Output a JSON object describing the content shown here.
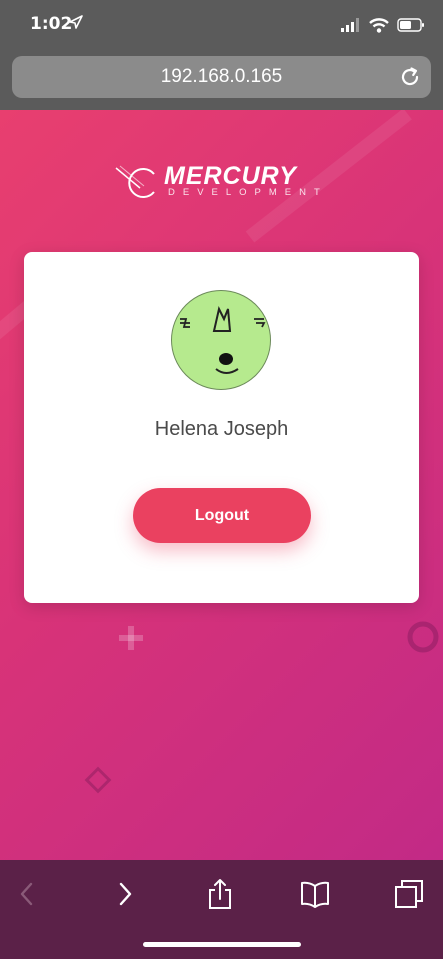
{
  "status_bar": {
    "time": "1:02",
    "icons": [
      "location-arrow-icon",
      "signal-icon",
      "wifi-icon",
      "battery-icon"
    ]
  },
  "browser": {
    "url": "192.168.0.165",
    "toolbar": [
      "back-icon",
      "forward-icon",
      "share-icon",
      "bookmarks-icon",
      "tabs-icon"
    ]
  },
  "logo": {
    "title": "MERCURY",
    "subtitle": "DEVELOPMENT"
  },
  "profile": {
    "name": "Helena Joseph",
    "logout_label": "Logout",
    "avatar_color": "#b6ea8e"
  },
  "colors": {
    "background_start": "#e83f6f",
    "background_end": "#c22a86",
    "button": "#ea4160",
    "toolbar": "#5b2148",
    "chrome": "#5b5b5b"
  }
}
